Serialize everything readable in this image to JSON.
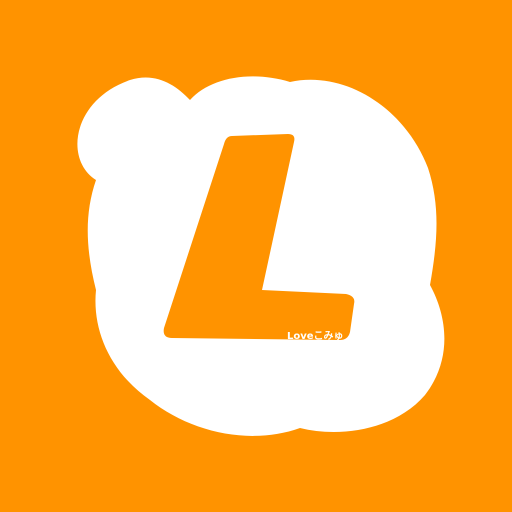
{
  "app_icon": {
    "glyph": "L",
    "caption": "Loveこみゅ",
    "colors": {
      "background": "#ff9300",
      "blob": "#ffffff",
      "glyph": "#ff9300",
      "caption": "#ffffff"
    }
  }
}
